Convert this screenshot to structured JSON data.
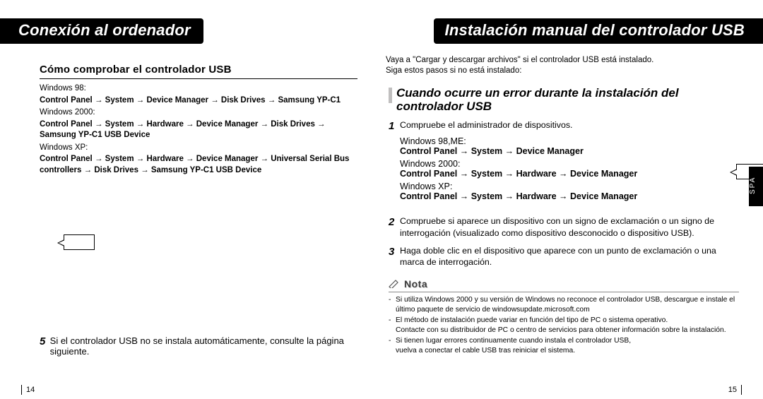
{
  "left": {
    "header": "Conexión al ordenador",
    "subtitle": "Cómo comprobar el controlador USB",
    "os": [
      {
        "name": "Windows 98:",
        "path": "Control Panel → System → Device Manager → Disk Drives → Samsung YP-C1"
      },
      {
        "name": "Windows 2000:",
        "path": "Control Panel → System → Hardware → Device Manager → Disk Drives → Samsung YP-C1  USB Device"
      },
      {
        "name": "Windows XP:",
        "path": "Control Panel → System → Hardware → Device Manager → Universal Serial Bus controllers → Disk Drives → Samsung YP-C1  USB Device"
      }
    ],
    "step5": {
      "num": "5",
      "text": "Si el controlador USB no se instala automáticamente, consulte la página siguiente."
    },
    "pageno": "14"
  },
  "right": {
    "header": "Instalación manual del controlador USB",
    "intro1": "Vaya a \"Cargar y descargar archivos\" si el controlador USB está instalado.",
    "intro2": "Siga estos pasos si no está instalado:",
    "section_title": "Cuando ocurre un error durante la instalación del controlador USB",
    "steps": [
      {
        "num": "1",
        "text": "Compruebe el administrador de dispositivos."
      },
      {
        "num": "2",
        "text": "Compruebe si aparece un dispositivo con un signo de exclamación o un signo de interrogación (visualizado como dispositivo desconocido o dispositivo USB)."
      },
      {
        "num": "3",
        "text": "Haga doble clic en el dispositivo que aparece con un punto de exclamación o una marca de interrogación."
      }
    ],
    "osblocks": [
      {
        "name": "Windows 98,ME:",
        "path": "Control Panel → System → Device Manager"
      },
      {
        "name": "Windows 2000:",
        "path": "Control Panel → System → Hardware → Device Manager"
      },
      {
        "name": "Windows XP:",
        "path": "Control Panel → System → Hardware → Device Manager"
      }
    ],
    "nota_label": "Nota",
    "nota": [
      {
        "main": "Si utiliza Windows 2000 y su versión de Windows no reconoce el controlador USB, descargue e instale el último paquete de servicio de windowsupdate.microsoft.com"
      },
      {
        "main": "El método de instalación puede variar en función del tipo de PC o sistema operativo.",
        "sub": "Contacte con su distribuidor de PC o centro de servicios para obtener información sobre la instalación."
      },
      {
        "main": "Si tienen lugar errores continuamente cuando instala el controlador USB,",
        "sub": "vuelva a conectar el cable USB tras reiniciar el sistema."
      }
    ],
    "side_tab": "SPA",
    "pageno": "15"
  }
}
